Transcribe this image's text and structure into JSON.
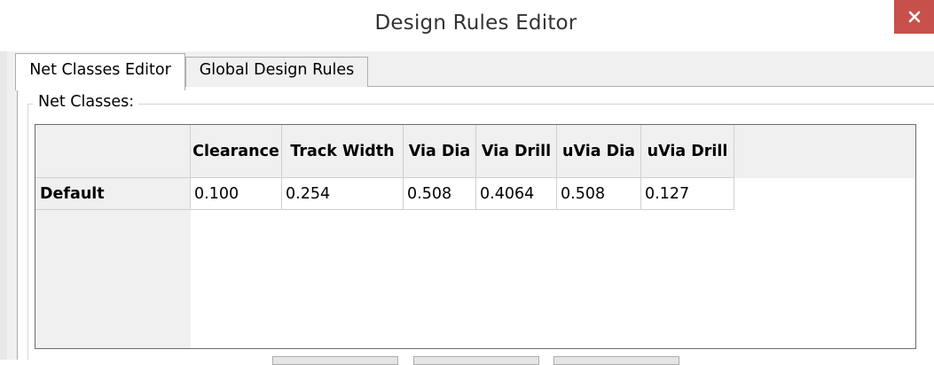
{
  "window": {
    "title": "Design Rules Editor",
    "close_icon": "close-icon",
    "close_color": "#c7504b"
  },
  "tabs": [
    {
      "label": "Net Classes Editor",
      "active": true
    },
    {
      "label": "Global Design Rules",
      "active": false
    }
  ],
  "net_classes": {
    "group_label": "Net Classes:",
    "columns": [
      "Clearance",
      "Track Width",
      "Via Dia",
      "Via Drill",
      "uVia Dia",
      "uVia Drill"
    ],
    "rows": [
      {
        "name": "Default",
        "values": [
          "0.100",
          "0.254",
          "0.508",
          "0.4064",
          "0.508",
          "0.127"
        ]
      }
    ]
  }
}
